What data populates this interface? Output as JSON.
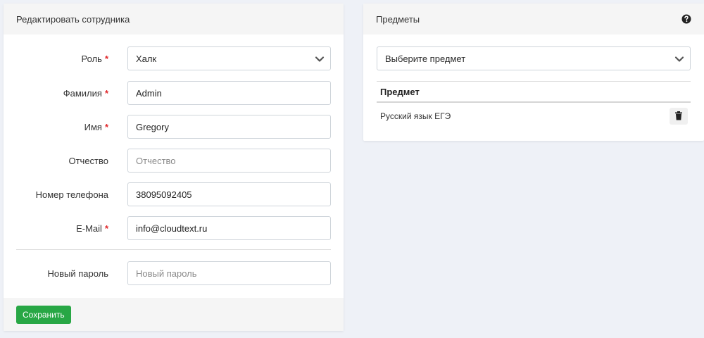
{
  "edit_form": {
    "title": "Редактировать сотрудника",
    "fields": [
      {
        "label": "Роль",
        "required": "*",
        "value": "Халк",
        "type": "select"
      },
      {
        "label": "Фамилия",
        "required": "*",
        "value": "Admin",
        "placeholder": ""
      },
      {
        "label": "Имя",
        "required": "*",
        "value": "Gregory",
        "placeholder": ""
      },
      {
        "label": "Отчество",
        "value": "",
        "placeholder": "Отчество"
      },
      {
        "label": "Номер телефона",
        "value": "38095092405",
        "placeholder": ""
      },
      {
        "label": "E-Mail",
        "required": "*",
        "value": "info@cloudtext.ru",
        "placeholder": ""
      }
    ],
    "password": {
      "label": "Новый пароль",
      "value": "",
      "placeholder": "Новый пароль"
    },
    "save_label": "Сохранить"
  },
  "subjects": {
    "title": "Предметы",
    "help_icon": "question-circle-icon",
    "select_placeholder": "Выберите предмет",
    "table_header": "Предмет",
    "rows": [
      {
        "name": "Русский язык ЕГЭ",
        "action_icon": "trash-icon"
      }
    ]
  },
  "colors": {
    "accent_green": "#28a745",
    "required_red": "#e0262a",
    "background": "#eef1f7"
  }
}
